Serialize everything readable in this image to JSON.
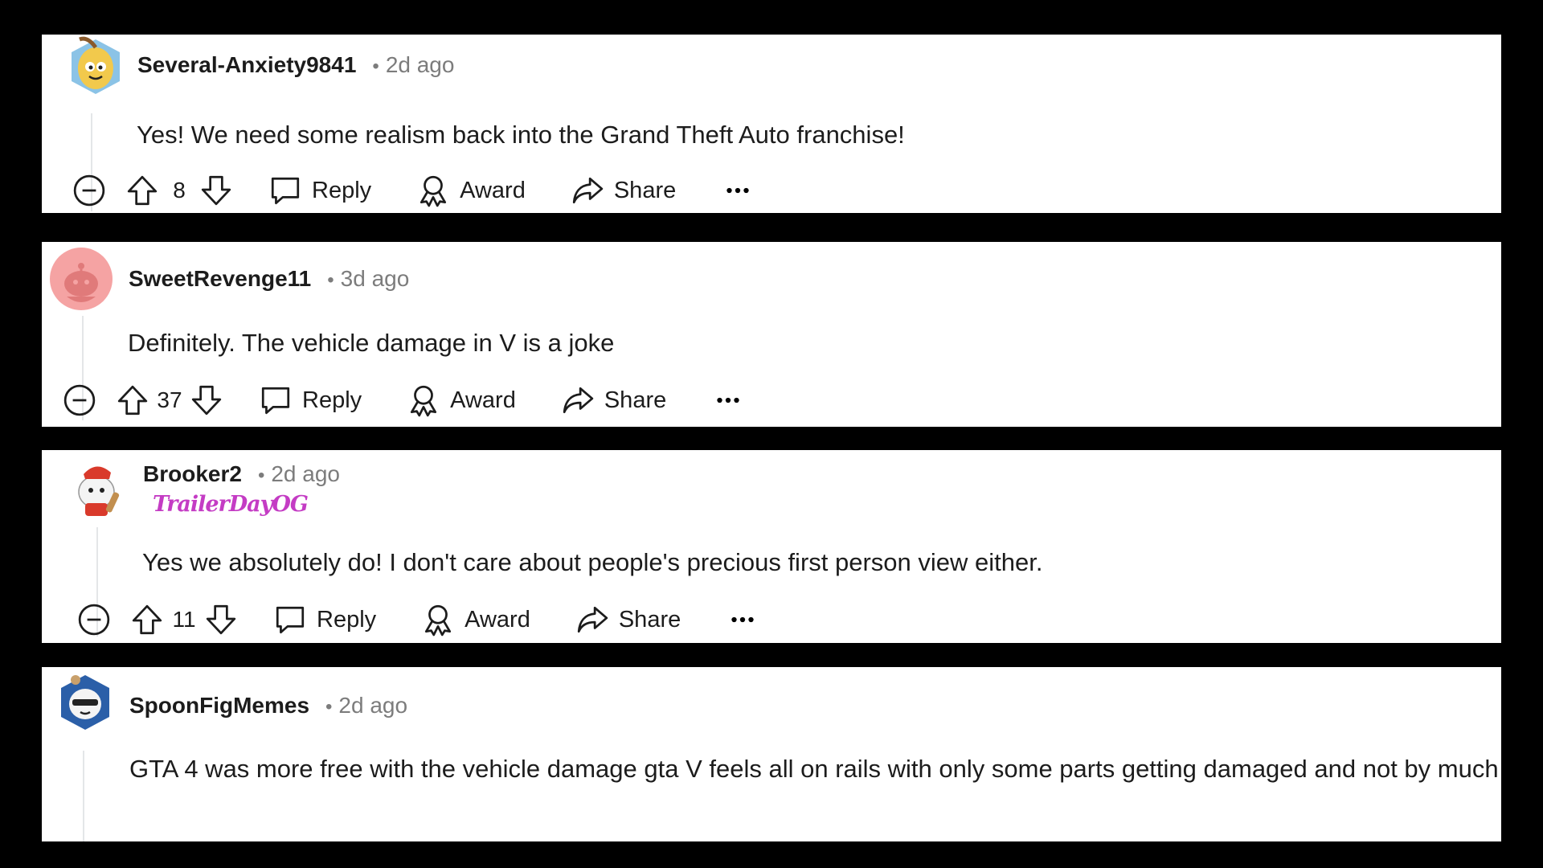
{
  "actions": {
    "reply": "Reply",
    "award": "Award",
    "share": "Share"
  },
  "comments": [
    {
      "username": "Several-Anxiety9841",
      "age": "2d ago",
      "flair": "",
      "score": "8",
      "body": "Yes! We need some realism back into the Grand Theft Auto franchise!",
      "avatar_icon": "banana-snoo-avatar",
      "avatar_color": "#f2c94c"
    },
    {
      "username": "SweetRevenge11",
      "age": "3d ago",
      "flair": "",
      "score": "37",
      "body": "Definitely. The vehicle damage in V is a joke",
      "avatar_icon": "default-snoo-avatar",
      "avatar_color": "#f5a3a3"
    },
    {
      "username": "Brooker2",
      "age": "2d ago",
      "flair": "TrailerDayOG",
      "score": "11",
      "body": "Yes we absolutely do! I don't care about people's precious first person view either.",
      "avatar_icon": "chef-snoo-avatar",
      "avatar_color": "#d93a2b"
    },
    {
      "username": "SpoonFigMemes",
      "age": "2d ago",
      "flair": "",
      "score": "",
      "body": "GTA 4 was more free with the vehicle damage gta V feels all on rails with only some parts getting damaged and not by much",
      "avatar_icon": "sunglasses-snoo-avatar",
      "avatar_color": "#2b5fa8"
    }
  ]
}
